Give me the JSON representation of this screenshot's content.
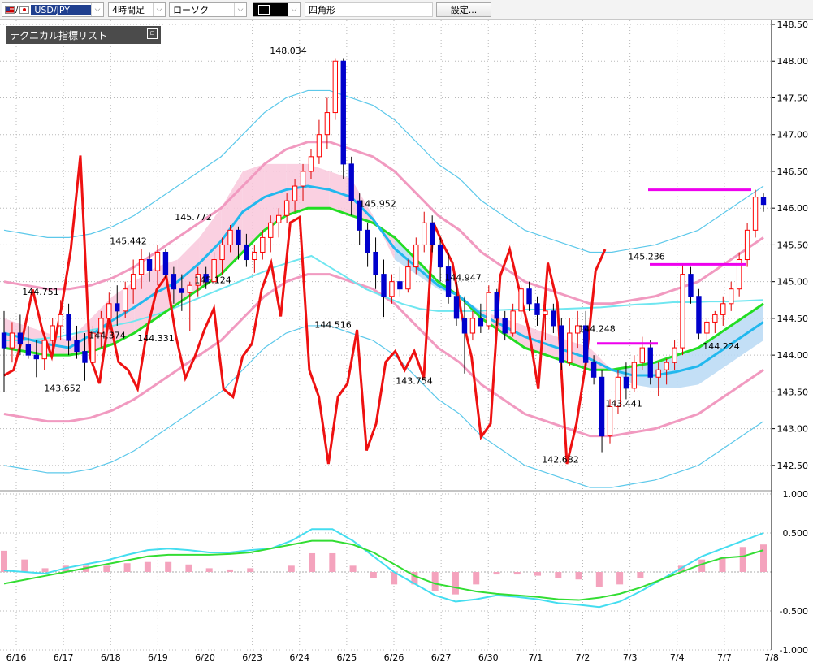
{
  "toolbar": {
    "currency_pair": "USD/JPY",
    "timeframe": "4時間足",
    "chart_style": "ローソク",
    "draw_color_label": "ロ",
    "draw_shape": "四角形",
    "settings_label": "設定..."
  },
  "panel": {
    "title": "テクニカル指標リスト",
    "button_icon": "restore-icon"
  },
  "colors": {
    "up_candle": "#ff0000",
    "down_candle": "#0000cc",
    "ichimoku_cloud_up": "#b9d9f5",
    "ichimoku_cloud_down": "#f9c8dc",
    "rsi_line": "#ee1111",
    "bollinger_outer": "#5cc8ea",
    "bollinger_inner": "#f19ac0",
    "kijun": "#22dd22",
    "tenkan": "#22b8ee",
    "trendline": "#ee00ee",
    "macd_line": "#44ddf0",
    "signal_line": "#33dd33",
    "histogram": "#f4a3bd"
  },
  "chart_data": {
    "type": "line",
    "price_axis_ticks": [
      "148.50",
      "148.00",
      "147.50",
      "147.00",
      "146.50",
      "146.00",
      "145.50",
      "145.00",
      "144.50",
      "144.00",
      "143.50",
      "143.00",
      "142.50"
    ],
    "macd_axis_ticks": [
      "1.000",
      "0.500",
      "-0.500",
      "-1.000"
    ],
    "x_tick_labels": [
      "6/16",
      "6/17",
      "6/18",
      "6/19",
      "6/20",
      "6/23",
      "6/24",
      "6/25",
      "6/26",
      "6/27",
      "6/30",
      "7/1",
      "7/2",
      "7/3",
      "7/4",
      "7/7",
      "7/8"
    ],
    "annotations": [
      "148.034",
      "145.952",
      "145.772",
      "145.442",
      "145.124",
      "144.947",
      "144.751",
      "144.516",
      "144.374",
      "144.331",
      "144.248",
      "145.236",
      "144.224",
      "143.754",
      "143.652",
      "143.441",
      "142.682"
    ],
    "ylim_price": [
      142.2,
      148.5
    ],
    "ylim_macd": [
      -1.0,
      1.0
    ],
    "ohlc": [
      [
        144.3,
        144.6,
        143.5,
        144.1
      ],
      [
        144.1,
        144.45,
        143.9,
        144.3
      ],
      [
        144.3,
        144.55,
        144.0,
        144.15
      ],
      [
        144.15,
        144.4,
        143.95,
        144.0
      ],
      [
        144.0,
        144.2,
        143.7,
        143.95
      ],
      [
        143.95,
        144.3,
        143.8,
        144.2
      ],
      [
        144.2,
        144.5,
        144.05,
        144.4
      ],
      [
        144.4,
        144.75,
        144.2,
        144.55
      ],
      [
        144.55,
        144.7,
        144.0,
        144.2
      ],
      [
        144.2,
        144.4,
        143.95,
        144.05
      ],
      [
        144.05,
        144.3,
        143.65,
        143.9
      ],
      [
        143.9,
        144.4,
        143.85,
        144.3
      ],
      [
        144.3,
        144.6,
        144.1,
        144.5
      ],
      [
        144.5,
        144.85,
        144.35,
        144.7
      ],
      [
        144.7,
        144.95,
        144.4,
        144.6
      ],
      [
        144.6,
        145.0,
        144.5,
        144.9
      ],
      [
        144.9,
        145.3,
        144.7,
        145.1
      ],
      [
        145.1,
        145.44,
        144.9,
        145.3
      ],
      [
        145.3,
        145.4,
        145.0,
        145.15
      ],
      [
        145.15,
        145.5,
        144.95,
        145.4
      ],
      [
        145.4,
        145.45,
        145.05,
        145.1
      ],
      [
        145.1,
        145.2,
        144.7,
        144.9
      ],
      [
        144.9,
        145.1,
        144.6,
        144.85
      ],
      [
        144.85,
        145.0,
        144.33,
        144.95
      ],
      [
        144.95,
        145.2,
        144.8,
        145.1
      ],
      [
        145.1,
        145.2,
        144.9,
        145.0
      ],
      [
        145.0,
        145.4,
        144.95,
        145.3
      ],
      [
        145.3,
        145.6,
        145.1,
        145.5
      ],
      [
        145.5,
        145.77,
        145.4,
        145.7
      ],
      [
        145.7,
        145.75,
        145.3,
        145.5
      ],
      [
        145.5,
        145.65,
        145.2,
        145.3
      ],
      [
        145.3,
        145.5,
        145.12,
        145.4
      ],
      [
        145.4,
        145.7,
        145.3,
        145.6
      ],
      [
        145.6,
        145.9,
        145.4,
        145.8
      ],
      [
        145.8,
        146.0,
        145.6,
        145.9
      ],
      [
        145.9,
        146.2,
        145.8,
        146.1
      ],
      [
        146.1,
        146.4,
        145.95,
        146.3
      ],
      [
        146.3,
        146.6,
        146.1,
        146.5
      ],
      [
        146.5,
        146.8,
        146.4,
        146.7
      ],
      [
        146.7,
        147.2,
        146.6,
        147.0
      ],
      [
        147.0,
        147.5,
        146.8,
        147.3
      ],
      [
        147.3,
        148.03,
        147.2,
        148.0
      ],
      [
        148.0,
        148.03,
        146.4,
        146.6
      ],
      [
        146.6,
        146.7,
        145.9,
        146.1
      ],
      [
        146.1,
        146.2,
        145.5,
        145.7
      ],
      [
        145.7,
        145.8,
        145.2,
        145.4
      ],
      [
        145.4,
        145.6,
        144.9,
        145.1
      ],
      [
        145.1,
        145.3,
        144.52,
        144.8
      ],
      [
        144.8,
        145.1,
        144.7,
        145.0
      ],
      [
        145.0,
        145.2,
        144.8,
        144.9
      ],
      [
        144.9,
        145.3,
        144.85,
        145.2
      ],
      [
        145.2,
        145.6,
        145.1,
        145.5
      ],
      [
        145.5,
        145.95,
        145.4,
        145.8
      ],
      [
        145.8,
        145.9,
        145.4,
        145.5
      ],
      [
        145.5,
        145.6,
        145.0,
        145.2
      ],
      [
        145.2,
        145.4,
        144.7,
        144.8
      ],
      [
        144.8,
        145.0,
        144.4,
        144.5
      ],
      [
        144.5,
        144.8,
        143.75,
        144.3
      ],
      [
        144.3,
        144.6,
        144.2,
        144.5
      ],
      [
        144.5,
        144.7,
        144.3,
        144.4
      ],
      [
        144.4,
        144.95,
        144.35,
        144.85
      ],
      [
        144.85,
        144.9,
        144.4,
        144.5
      ],
      [
        144.5,
        144.6,
        144.2,
        144.3
      ],
      [
        144.3,
        144.7,
        144.25,
        144.6
      ],
      [
        144.6,
        144.95,
        144.5,
        144.9
      ],
      [
        144.9,
        145.0,
        144.6,
        144.7
      ],
      [
        144.7,
        144.8,
        144.4,
        144.55
      ],
      [
        144.55,
        144.7,
        144.2,
        144.6
      ],
      [
        144.6,
        144.7,
        144.3,
        144.4
      ],
      [
        144.4,
        144.5,
        143.8,
        143.9
      ],
      [
        143.9,
        144.5,
        143.85,
        144.3
      ],
      [
        144.3,
        144.6,
        144.1,
        144.4
      ],
      [
        144.4,
        144.6,
        143.8,
        143.9
      ],
      [
        143.9,
        144.0,
        143.6,
        143.7
      ],
      [
        143.7,
        143.8,
        142.68,
        142.9
      ],
      [
        142.9,
        143.4,
        142.8,
        143.3
      ],
      [
        143.3,
        143.8,
        143.2,
        143.7
      ],
      [
        143.7,
        143.9,
        143.4,
        143.55
      ],
      [
        143.55,
        144.0,
        143.5,
        143.9
      ],
      [
        143.9,
        144.25,
        143.8,
        144.1
      ],
      [
        144.1,
        144.2,
        143.6,
        143.7
      ],
      [
        143.7,
        143.9,
        143.44,
        143.8
      ],
      [
        143.8,
        143.95,
        143.6,
        143.9
      ],
      [
        143.9,
        144.2,
        143.8,
        144.1
      ],
      [
        144.1,
        145.24,
        144.0,
        145.1
      ],
      [
        145.1,
        145.2,
        144.7,
        144.8
      ],
      [
        144.8,
        144.9,
        144.22,
        144.3
      ],
      [
        144.3,
        144.5,
        144.2,
        144.45
      ],
      [
        144.45,
        144.6,
        144.3,
        144.55
      ],
      [
        144.55,
        144.8,
        144.4,
        144.7
      ],
      [
        144.7,
        145.0,
        144.6,
        144.9
      ],
      [
        144.9,
        145.4,
        144.8,
        145.3
      ],
      [
        145.3,
        145.8,
        145.2,
        145.7
      ],
      [
        145.7,
        146.25,
        145.6,
        146.15
      ],
      [
        146.15,
        146.2,
        145.95,
        146.05
      ]
    ],
    "series": [
      {
        "values": [
          13,
          15,
          28,
          45,
          30,
          20,
          38,
          60,
          95,
          20,
          10,
          35,
          18,
          15,
          8,
          30,
          45,
          50,
          28,
          12,
          20,
          30,
          38,
          8,
          5,
          20,
          25,
          45,
          55,
          35,
          70,
          72,
          15,
          5,
          -20,
          5,
          10,
          30,
          -15,
          -5,
          18,
          22,
          15,
          22,
          12,
          70,
          62,
          55,
          35,
          20,
          -10,
          -5,
          50,
          60,
          45,
          30,
          8,
          55,
          40,
          -20,
          -5,
          18,
          52,
          60
        ]
      },
      {
        "values": [
          144.2,
          144.2,
          144.22,
          144.25,
          144.3,
          144.35,
          144.4,
          144.45,
          144.52,
          144.6,
          144.7,
          144.8,
          144.9,
          145.0,
          145.1,
          145.2,
          145.28,
          145.35,
          145.2,
          145.05,
          144.9,
          144.8,
          144.7,
          144.63,
          144.6,
          144.6,
          144.6,
          144.61,
          144.62,
          144.62,
          144.62,
          144.63,
          144.64,
          144.65,
          144.67,
          144.69,
          144.7,
          144.72,
          144.72,
          144.73,
          144.73,
          144.74,
          144.75
        ]
      },
      {
        "values": [
          144.1,
          144.05,
          144.0,
          144.0,
          144.05,
          144.15,
          144.3,
          144.5,
          144.7,
          144.9,
          145.1,
          145.4,
          145.7,
          145.9,
          146.0,
          146.0,
          145.9,
          145.8,
          145.6,
          145.3,
          145.0,
          144.8,
          144.5,
          144.3,
          144.1,
          144.0,
          143.9,
          143.8,
          143.8,
          143.85,
          143.9,
          144.0,
          144.1,
          144.3,
          144.5,
          144.7
        ]
      },
      {
        "values": [
          144.5,
          144.4,
          144.3,
          144.2,
          144.5,
          144.8,
          145.0,
          145.2,
          145.3,
          145.6,
          146.0,
          146.5,
          146.6,
          146.6,
          146.6,
          146.5,
          146.4,
          145.9,
          145.3,
          145.1,
          144.9,
          144.8,
          144.6,
          144.5,
          144.4,
          144.3,
          144.2,
          144.1,
          143.8,
          143.6,
          143.55,
          143.55,
          143.6,
          143.8,
          144.0,
          144.2
        ]
      },
      {
        "values": [
          0.02,
          0.0,
          -0.02,
          0.05,
          0.1,
          0.15,
          0.22,
          0.28,
          0.3,
          0.28,
          0.25,
          0.25,
          0.28,
          0.3,
          0.4,
          0.55,
          0.55,
          0.4,
          0.2,
          0.0,
          -0.15,
          -0.3,
          -0.38,
          -0.35,
          -0.3,
          -0.32,
          -0.35,
          -0.4,
          -0.42,
          -0.45,
          -0.38,
          -0.25,
          -0.1,
          0.05,
          0.2,
          0.3,
          0.4,
          0.5
        ]
      },
      {
        "values": [
          -0.15,
          -0.1,
          -0.05,
          0.0,
          0.05,
          0.1,
          0.15,
          0.2,
          0.22,
          0.22,
          0.22,
          0.23,
          0.25,
          0.3,
          0.35,
          0.4,
          0.4,
          0.35,
          0.25,
          0.1,
          -0.05,
          -0.15,
          -0.2,
          -0.25,
          -0.28,
          -0.3,
          -0.32,
          -0.35,
          -0.36,
          -0.33,
          -0.28,
          -0.2,
          -0.1,
          0.0,
          0.1,
          0.18,
          0.2,
          0.28
        ]
      }
    ]
  }
}
